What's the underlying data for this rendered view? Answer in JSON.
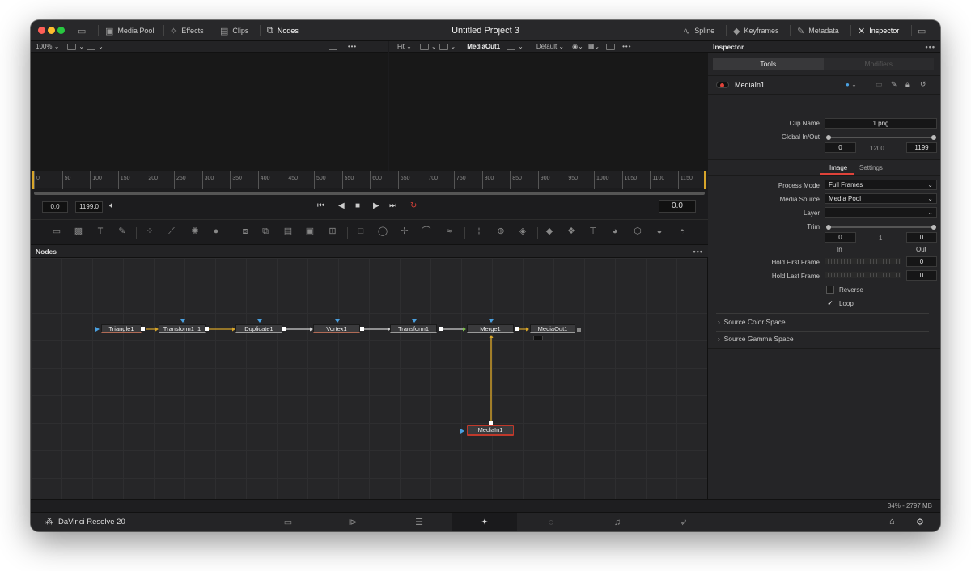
{
  "titlebar": {
    "title": "Untitled Project 3",
    "left_items": [
      {
        "label": "Media Pool",
        "icon": "media-pool-icon"
      },
      {
        "label": "Effects",
        "icon": "effects-icon"
      },
      {
        "label": "Clips",
        "icon": "clips-icon"
      },
      {
        "label": "Nodes",
        "icon": "nodes-icon"
      }
    ],
    "right_items": [
      {
        "label": "Spline",
        "icon": "spline-icon"
      },
      {
        "label": "Keyframes",
        "icon": "keyframes-icon"
      },
      {
        "label": "Metadata",
        "icon": "metadata-icon"
      },
      {
        "label": "Inspector",
        "icon": "inspector-icon"
      }
    ]
  },
  "viewer": {
    "zoom": "100%",
    "fit": "Fit",
    "output_name": "MediaOut1",
    "lut": "Default",
    "ruler_ticks": [
      "0",
      "50",
      "100",
      "150",
      "200",
      "250",
      "300",
      "350",
      "400",
      "450",
      "500",
      "550",
      "600",
      "650",
      "700",
      "750",
      "800",
      "850",
      "900",
      "950",
      "1000",
      "1050",
      "1100",
      "1150"
    ],
    "start_field": "0.0",
    "end_field": "1199.0",
    "current_time": "0.0"
  },
  "nodes_panel": {
    "title": "Nodes",
    "nodes": [
      "Triangle1",
      "Transform1_1",
      "Duplicate1",
      "Vortex1",
      "Transform1",
      "Merge1",
      "MediaOut1",
      "MediaIn1"
    ]
  },
  "inspector": {
    "title": "Inspector",
    "tabs": [
      "Tools",
      "Modifiers"
    ],
    "tool_name": "MediaIn1",
    "clip_name_label": "Clip Name",
    "clip_name": "1.png",
    "global_label": "Global In/Out",
    "global_in": "0",
    "global_mid": "1200",
    "global_out": "1199",
    "sub_tabs": [
      "Image",
      "Settings"
    ],
    "process_mode_label": "Process Mode",
    "process_mode": "Full Frames",
    "media_source_label": "Media Source",
    "media_source": "Media Pool",
    "layer_label": "Layer",
    "layer": "",
    "trim_label": "Trim",
    "trim_in": "0",
    "trim_mid": "1",
    "trim_out": "0",
    "in_label": "In",
    "out_label": "Out",
    "hold_first_label": "Hold First Frame",
    "hold_first": "0",
    "hold_last_label": "Hold Last Frame",
    "hold_last": "0",
    "reverse_label": "Reverse",
    "loop_label": "Loop",
    "source_color_space": "Source Color Space",
    "source_gamma_space": "Source Gamma Space"
  },
  "status": {
    "memory": "34% - 2797 MB"
  },
  "pagebar": {
    "brand": "DaVinci Resolve 20"
  }
}
